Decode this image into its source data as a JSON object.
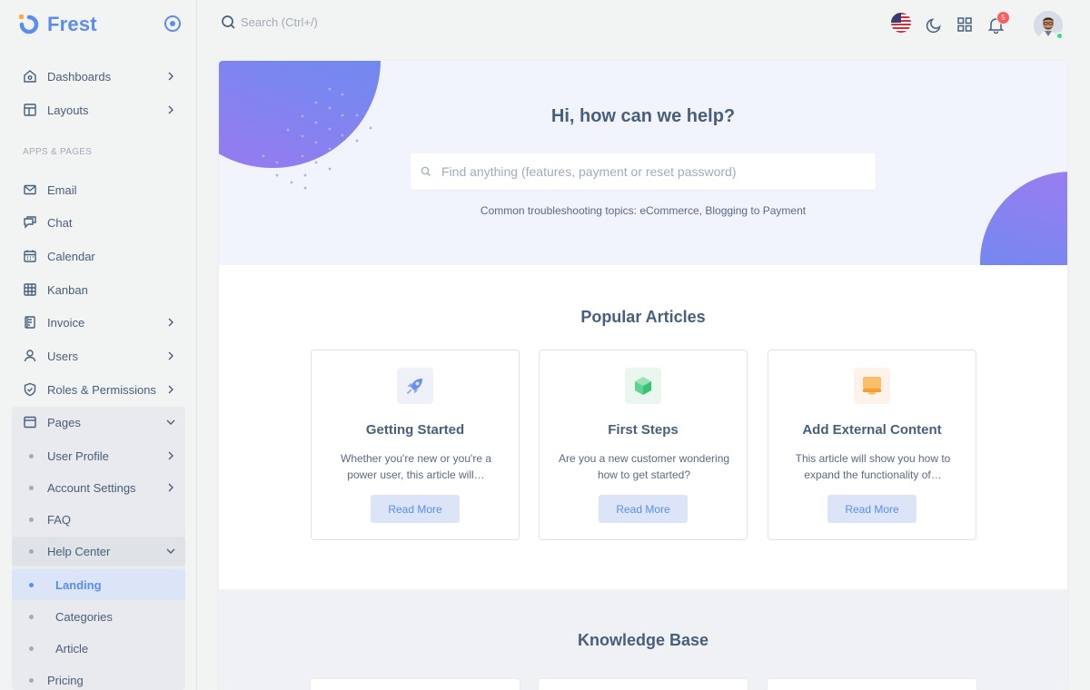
{
  "brand": {
    "name": "Frest"
  },
  "sidebar": {
    "section_label": "APPS & PAGES",
    "top_items": [
      {
        "label": "Dashboards",
        "icon": "home-icon"
      },
      {
        "label": "Layouts",
        "icon": "layout-icon"
      }
    ],
    "items": [
      {
        "label": "Email",
        "icon": "mail-icon"
      },
      {
        "label": "Chat",
        "icon": "chat-icon"
      },
      {
        "label": "Calendar",
        "icon": "calendar-icon"
      },
      {
        "label": "Kanban",
        "icon": "grid-icon"
      },
      {
        "label": "Invoice",
        "icon": "file-icon"
      },
      {
        "label": "Users",
        "icon": "user-icon"
      },
      {
        "label": "Roles & Permissions",
        "icon": "shield-icon"
      },
      {
        "label": "Pages",
        "icon": "window-icon"
      }
    ],
    "pages_sub": [
      {
        "label": "User Profile"
      },
      {
        "label": "Account Settings"
      },
      {
        "label": "FAQ"
      },
      {
        "label": "Help Center"
      }
    ],
    "help_sub": [
      {
        "label": "Landing",
        "active": true
      },
      {
        "label": "Categories"
      },
      {
        "label": "Article"
      }
    ],
    "pricing": {
      "label": "Pricing"
    }
  },
  "topbar": {
    "search_placeholder": "Search (Ctrl+/)",
    "notification_count": "5"
  },
  "hero": {
    "title": "Hi, how can we help?",
    "search_placeholder": "Find anything (features, payment or reset password)",
    "subtitle": "Common troubleshooting topics: eCommerce, Blogging to Payment"
  },
  "popular": {
    "title": "Popular Articles",
    "cards": [
      {
        "title": "Getting Started",
        "desc": "Whether you're new or you're a power user, this article will…",
        "button": "Read More",
        "icon": "rocket-icon"
      },
      {
        "title": "First Steps",
        "desc": "Are you a new customer wondering how to get started?",
        "button": "Read More",
        "icon": "cube-icon"
      },
      {
        "title": "Add External Content",
        "desc": "This article will show you how to expand the functionality of…",
        "button": "Read More",
        "icon": "laptop-icon"
      }
    ]
  },
  "knowledge_base": {
    "title": "Knowledge Base"
  },
  "colors": {
    "accent": "#5a8dee",
    "text": "#475f7b",
    "muted": "#a1acb8",
    "danger": "#ff5b5c",
    "success": "#39da8a"
  }
}
